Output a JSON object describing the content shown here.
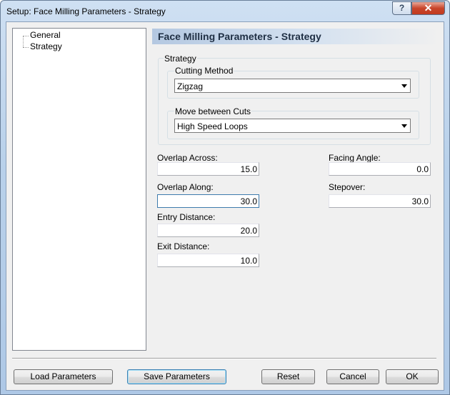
{
  "window": {
    "title": "Setup: Face Milling Parameters - Strategy",
    "help_label": "?",
    "close_label": "✕"
  },
  "tree": {
    "items": [
      {
        "label": "General"
      },
      {
        "label": "Strategy"
      }
    ]
  },
  "panel": {
    "title": "Face Milling Parameters - Strategy"
  },
  "strategy": {
    "group_label": "Strategy",
    "cutting_method": {
      "label": "Cutting Method",
      "value": "Zigzag"
    },
    "move_between_cuts": {
      "label": "Move between Cuts",
      "value": "High Speed Loops"
    }
  },
  "fields": {
    "overlap_across": {
      "label": "Overlap Across:",
      "value": "15.0"
    },
    "overlap_along": {
      "label": "Overlap Along:",
      "value": "30.0"
    },
    "entry_distance": {
      "label": "Entry Distance:",
      "value": "20.0"
    },
    "exit_distance": {
      "label": "Exit Distance:",
      "value": "10.0"
    },
    "facing_angle": {
      "label": "Facing Angle:",
      "value": "0.0"
    },
    "stepover": {
      "label": "Stepover:",
      "value": "30.0"
    }
  },
  "buttons": {
    "load": "Load Parameters",
    "save": "Save Parameters",
    "reset": "Reset",
    "cancel": "Cancel",
    "ok": "OK"
  }
}
